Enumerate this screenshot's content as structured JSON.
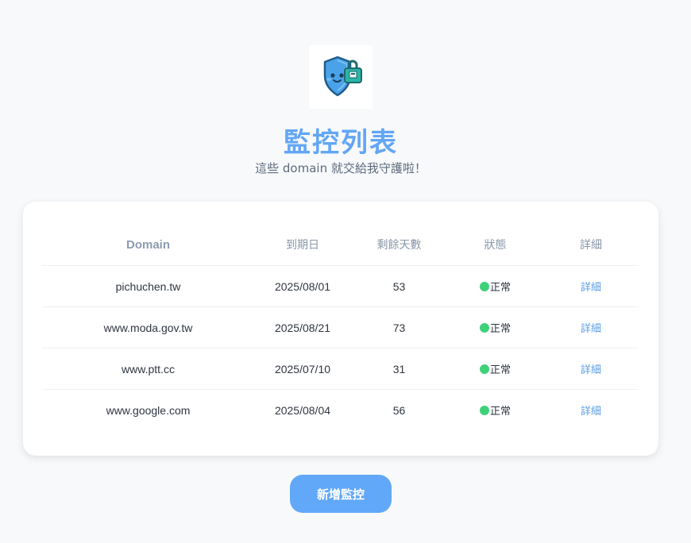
{
  "header": {
    "logo_icon": "shield-lock-icon",
    "title": "監控列表",
    "subtitle": "這些 domain 就交給我守護啦！"
  },
  "table": {
    "columns": [
      "Domain",
      "到期日",
      "剩餘天數",
      "狀態",
      "詳細"
    ],
    "rows": [
      {
        "domain": "pichuchen.tw",
        "expiry": "2025/08/01",
        "days_left": "53",
        "status": "正常",
        "detail": "詳細"
      },
      {
        "domain": "www.moda.gov.tw",
        "expiry": "2025/08/21",
        "days_left": "73",
        "status": "正常",
        "detail": "詳細"
      },
      {
        "domain": "www.ptt.cc",
        "expiry": "2025/07/10",
        "days_left": "31",
        "status": "正常",
        "detail": "詳細"
      },
      {
        "domain": "www.google.com",
        "expiry": "2025/08/04",
        "days_left": "56",
        "status": "正常",
        "detail": "詳細"
      }
    ]
  },
  "actions": {
    "add_label": "新增監控"
  },
  "colors": {
    "accent": "#63a6f4",
    "status_ok": "#3fd17a",
    "button": "#62a8f8"
  }
}
